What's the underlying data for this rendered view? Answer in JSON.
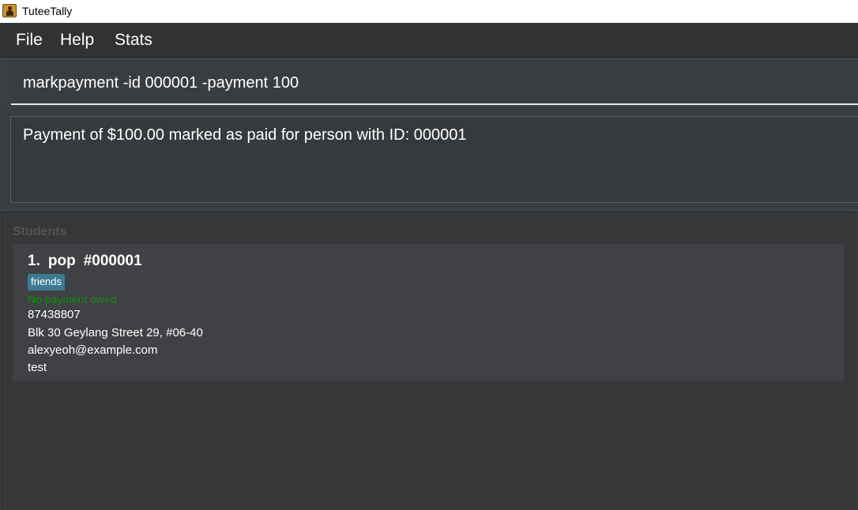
{
  "window": {
    "title": "TuteeTally"
  },
  "menu": {
    "items": [
      "File",
      "Help",
      "Stats"
    ]
  },
  "command": {
    "value": "markpayment -id 000001 -payment 100"
  },
  "result": {
    "message": "Payment of $100.00 marked as paid for person with ID: 000001"
  },
  "students": {
    "title": "Students",
    "items": [
      {
        "index": "1.",
        "name": "pop",
        "id": "#000001",
        "tag": "friends",
        "payment_status": "No payment owed",
        "phone": "87438807",
        "address": "Blk 30 Geylang Street 29, #06-40",
        "email": "alexyeoh@example.com",
        "remark": "test"
      }
    ]
  },
  "colors": {
    "tag_bg": "#3e7b91",
    "payment_ok": "#0e8f0e",
    "background": "#3c3f41"
  }
}
